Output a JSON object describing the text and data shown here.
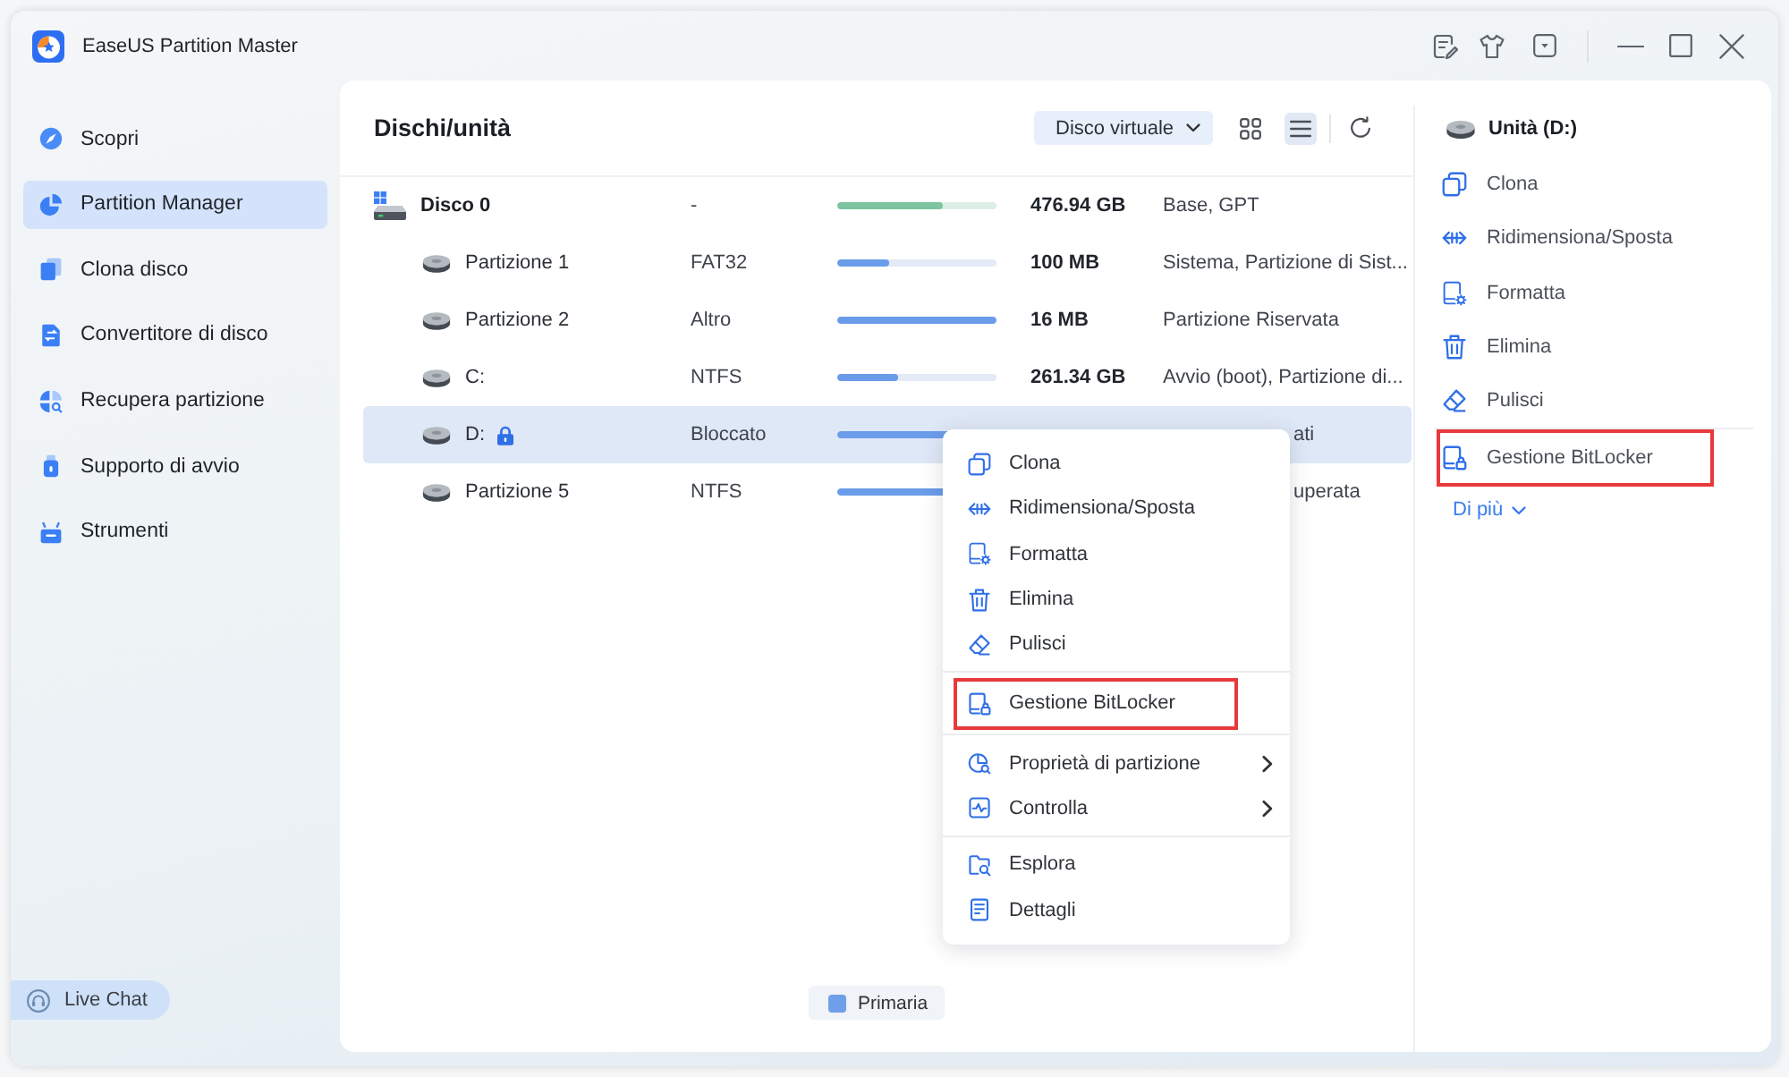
{
  "window": {
    "title": "EaseUS Partition Master"
  },
  "sidebar": {
    "items": [
      {
        "label": "Scopri",
        "selected": false
      },
      {
        "label": "Partition Manager",
        "selected": true
      },
      {
        "label": "Clona disco",
        "selected": false
      },
      {
        "label": "Convertitore di disco",
        "selected": false
      },
      {
        "label": "Recupera partizione",
        "selected": false
      },
      {
        "label": "Supporto di avvio",
        "selected": false
      },
      {
        "label": "Strumenti",
        "selected": false
      }
    ],
    "live_chat": "Live Chat"
  },
  "disks": {
    "title": "Dischi/unità",
    "toolbar": {
      "filter": "Disco virtuale",
      "views": [
        {
          "kind": "grid",
          "selected": false
        },
        {
          "kind": "list",
          "selected": true
        }
      ]
    },
    "rows": [
      {
        "kind": "disk",
        "name": "Disco 0",
        "file_system": "-",
        "level": 0.66,
        "size": "476.94 GB",
        "info": "Base, GPT",
        "selected": false,
        "locked": false
      },
      {
        "kind": "partition",
        "name": "Partizione 1",
        "file_system": "FAT32",
        "level": 0.33,
        "size": "100 MB",
        "info": "Sistema, Partizione di Sist...",
        "selected": false,
        "locked": false
      },
      {
        "kind": "partition",
        "name": "Partizione 2",
        "file_system": "Altro",
        "level": 1,
        "size": "16 MB",
        "info": "Partizione Riservata",
        "selected": false,
        "locked": false
      },
      {
        "kind": "partition",
        "name": "C:",
        "file_system": "NTFS",
        "level": 0.38,
        "size": "261.34 GB",
        "info": "Avvio (boot), Partizione di...",
        "selected": false,
        "locked": false
      },
      {
        "kind": "partition",
        "name": "D:",
        "file_system": "Bloccato",
        "level": 0.9,
        "info_tail": "ati",
        "selected": true,
        "locked": true
      },
      {
        "kind": "partition",
        "name": "Partizione 5",
        "file_system": "NTFS",
        "level": 0.9,
        "info_tail": "uperata",
        "selected": false,
        "locked": false
      }
    ],
    "legend": [
      {
        "label": "Primaria",
        "color": "#6f9fe8"
      }
    ]
  },
  "context_menu": {
    "groups": [
      {
        "items": [
          {
            "label": "Clona",
            "highlighted": false,
            "submenu": false
          },
          {
            "label": "Ridimensiona/Sposta",
            "highlighted": false,
            "submenu": false
          },
          {
            "label": "Formatta",
            "highlighted": false,
            "submenu": false
          },
          {
            "label": "Elimina",
            "highlighted": false,
            "submenu": false
          },
          {
            "label": "Pulisci",
            "highlighted": false,
            "submenu": false
          }
        ]
      },
      {
        "items": [
          {
            "label": "Gestione BitLocker",
            "highlighted": true,
            "submenu": false
          }
        ]
      },
      {
        "items": [
          {
            "label": "Proprietà di partizione",
            "highlighted": false,
            "submenu": true
          },
          {
            "label": "Controlla",
            "highlighted": false,
            "submenu": true
          }
        ]
      },
      {
        "items": [
          {
            "label": "Esplora",
            "highlighted": false,
            "submenu": false
          },
          {
            "label": "Dettagli",
            "highlighted": false,
            "submenu": false
          }
        ]
      }
    ]
  },
  "details": {
    "title": "Unità (D:)",
    "actions": [
      {
        "label": "Clona",
        "highlighted": false
      },
      {
        "label": "Ridimensiona/Sposta",
        "highlighted": false
      },
      {
        "label": "Formatta",
        "highlighted": false
      },
      {
        "label": "Elimina",
        "highlighted": false
      },
      {
        "label": "Pulisci",
        "highlighted": false
      },
      {
        "label": "Gestione BitLocker",
        "highlighted": true
      }
    ],
    "more": "Di più"
  }
}
